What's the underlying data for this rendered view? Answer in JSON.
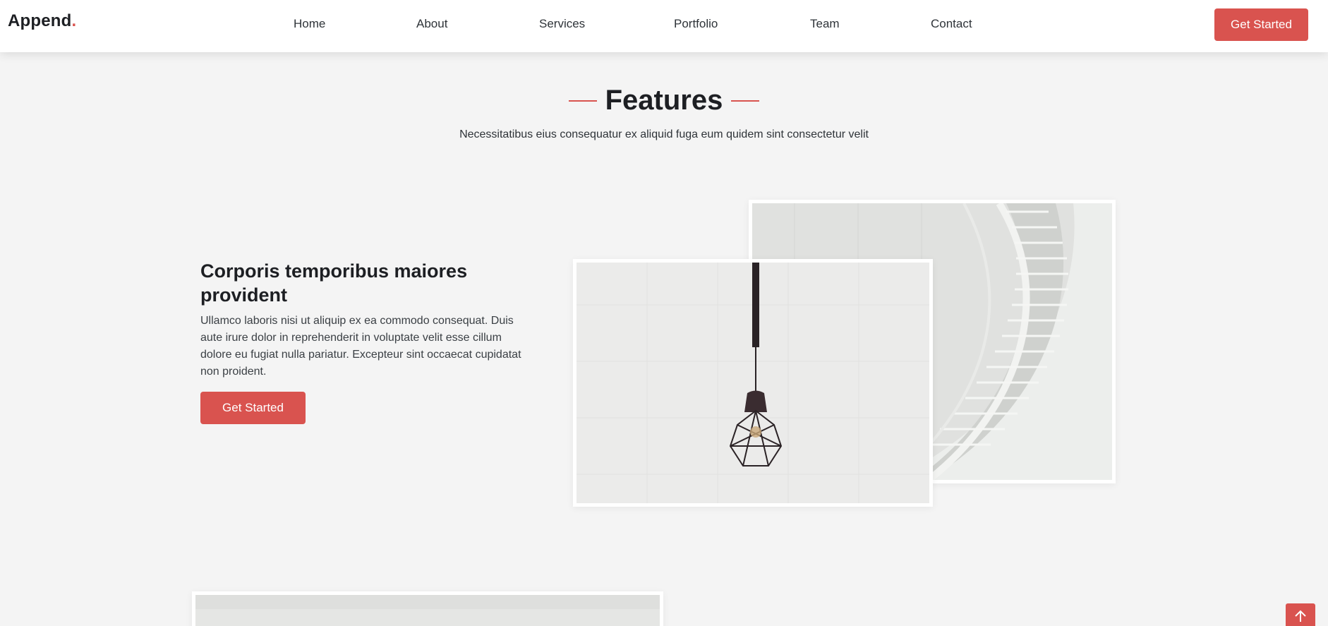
{
  "brand": {
    "name": "Append",
    "dot": "."
  },
  "nav": {
    "items": [
      {
        "label": "Home"
      },
      {
        "label": "About"
      },
      {
        "label": "Services"
      },
      {
        "label": "Portfolio"
      },
      {
        "label": "Team"
      },
      {
        "label": "Contact"
      }
    ],
    "cta_label": "Get Started"
  },
  "features": {
    "title": "Features",
    "subtitle": "Necessitatibus eius consequatur ex aliquid fuga eum quidem sint consectetur velit",
    "item": {
      "heading": "Corporis temporibus maiores provident",
      "text": "Ullamco laboris nisi ut aliquip ex ea commodo consequat. Duis aute irure dolor in reprehenderit in voluptate velit esse cillum dolore eu fugiat nulla pariatur. Excepteur sint occaecat cupidatat non proident.",
      "cta_label": "Get Started"
    }
  },
  "icons": {
    "back_to_top": "arrow-up-icon"
  },
  "colors": {
    "accent": "#d9534f",
    "background": "#f4f4f4",
    "heading": "#1d1f23"
  }
}
